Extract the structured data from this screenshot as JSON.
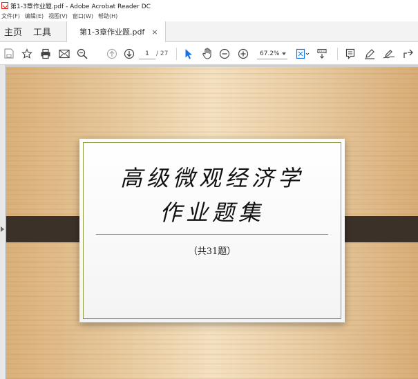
{
  "window": {
    "title": "第1-3章作业题.pdf - Adobe Acrobat Reader DC",
    "app_icon": "acrobat-icon"
  },
  "menu": [
    "文件(F)",
    "编辑(E)",
    "视图(V)",
    "窗口(W)",
    "帮助(H)"
  ],
  "tabs": {
    "home": "主页",
    "tools": "工具",
    "document": "第1-3章作业题.pdf",
    "close": "×"
  },
  "toolbar": {
    "icons": [
      "save-icon",
      "bookmark-star-icon",
      "print-icon",
      "email-icon",
      "search-icon",
      "previous-page-icon",
      "next-page-icon",
      "select-cursor-icon",
      "hand-tool-icon",
      "zoom-out-icon",
      "zoom-in-icon",
      "fit-page-icon",
      "scroll-mode-icon",
      "comment-icon",
      "highlight-pen-icon",
      "sign-icon",
      "share-icon"
    ],
    "current_page": "1",
    "total_pages": "/ 27",
    "zoom": "67.2%"
  },
  "colors": {
    "accent_blue": "#1473e6",
    "frame_green": "#8e9b3e",
    "band_dark": "#3b3128"
  },
  "document": {
    "title_line1": "高级微观经济学",
    "title_line2": "作业题集",
    "subtitle": "（共31题）"
  }
}
